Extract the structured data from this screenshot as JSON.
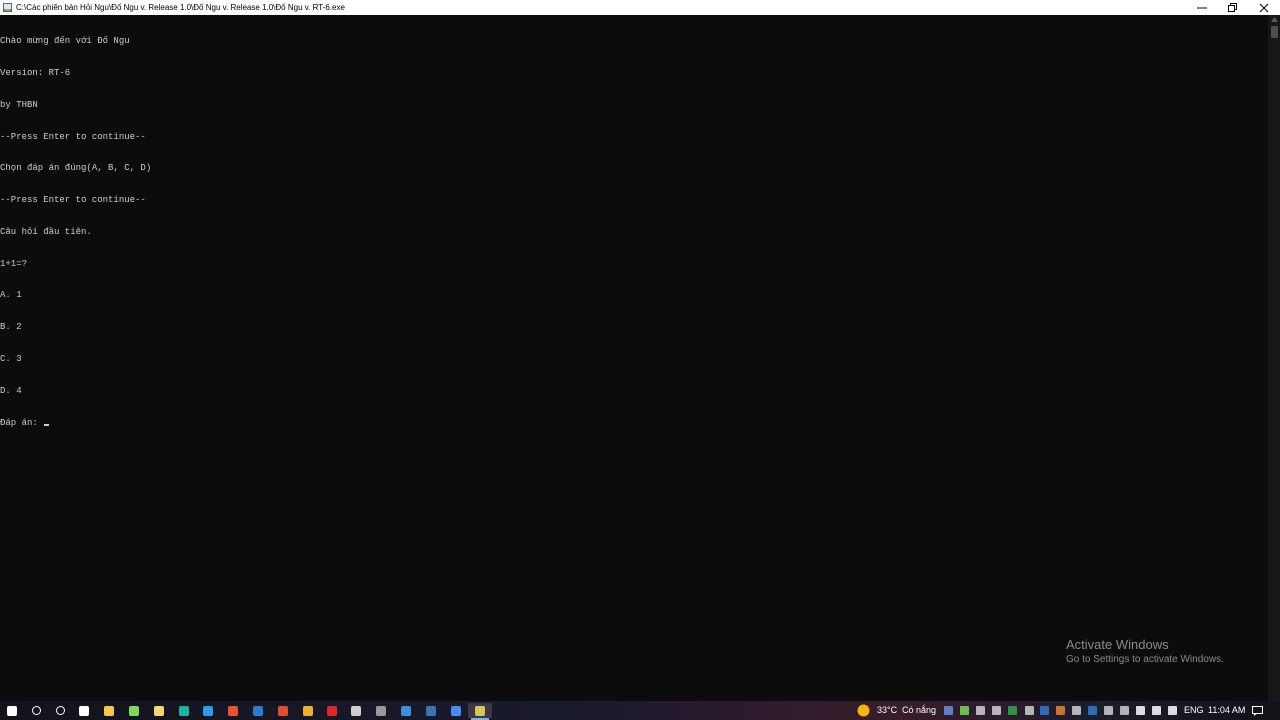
{
  "window": {
    "title": "C:\\Các phiên bản Hỏi Ngu\\Đố Ngu v. Release 1.0\\Đố Ngu v. Release 1.0\\Đố Ngu v. RT-6.exe",
    "controls": {
      "minimize": "—",
      "maximize": "❐",
      "close": "✕"
    }
  },
  "console": {
    "lines": [
      "Chào mừng đến với Đố Ngu",
      "Version: RT-6",
      "by THBN",
      "--Press Enter to continue--",
      "Chọn đáp án đúng(A, B, C, D)",
      "--Press Enter to continue--",
      "Câu hỏi đầu tiên.",
      "1+1=?",
      "A. 1",
      "B. 2",
      "C. 3",
      "D. 4"
    ],
    "prompt": "Đáp án: "
  },
  "watermark": {
    "title": "Activate Windows",
    "subtitle": "Go to Settings to activate Windows."
  },
  "taskbar": {
    "icons": [
      {
        "name": "start-icon",
        "color": "#ffffff"
      },
      {
        "name": "search-icon",
        "color": "#ffffff"
      },
      {
        "name": "cortana-icon",
        "color": "#ffffff"
      },
      {
        "name": "task-view-icon",
        "color": "#ffffff"
      },
      {
        "name": "file-explorer-icon",
        "color": "#f2c94c"
      },
      {
        "name": "store-icon",
        "color": "#7ed957"
      },
      {
        "name": "app-icon-1",
        "color": "#f5d76e"
      },
      {
        "name": "app-icon-2",
        "color": "#19b6a6"
      },
      {
        "name": "edge-icon",
        "color": "#2d9bf0"
      },
      {
        "name": "office-icon",
        "color": "#e8542e"
      },
      {
        "name": "mail-icon",
        "color": "#2b7cd3"
      },
      {
        "name": "app-icon-3",
        "color": "#e04f2e"
      },
      {
        "name": "chrome-icon",
        "color": "#e9b22a"
      },
      {
        "name": "opera-icon",
        "color": "#e0262c"
      },
      {
        "name": "pycharm-icon",
        "color": "#cfcfcf"
      },
      {
        "name": "terminal-icon",
        "color": "#9a9a9a"
      },
      {
        "name": "chat-icon",
        "color": "#3b8fe0"
      },
      {
        "name": "python-icon",
        "color": "#3a76b0"
      },
      {
        "name": "browser-icon",
        "color": "#4c8bf5"
      },
      {
        "name": "console-app-icon",
        "color": "#d9c65b"
      }
    ],
    "weather": {
      "temp": "33°C",
      "condition": "Có nắng"
    },
    "tray_icons": [
      {
        "name": "teams-icon",
        "color": "#6b8fe0"
      },
      {
        "name": "security-icon",
        "color": "#7ed957"
      },
      {
        "name": "tray-app-icon-1",
        "color": "#cfcfcf"
      },
      {
        "name": "tray-app-icon-2",
        "color": "#cfcfcf"
      },
      {
        "name": "tray-app-icon-3",
        "color": "#2fa84f"
      },
      {
        "name": "tray-app-icon-4",
        "color": "#cfcfcf"
      },
      {
        "name": "tray-app-icon-5",
        "color": "#2b7cd3"
      },
      {
        "name": "tray-app-icon-6",
        "color": "#e8842e"
      },
      {
        "name": "tray-app-icon-7",
        "color": "#cfcfcf"
      },
      {
        "name": "tray-app-icon-8",
        "color": "#2b7cd3"
      },
      {
        "name": "tray-app-icon-9",
        "color": "#cfcfcf"
      },
      {
        "name": "tray-app-icon-10",
        "color": "#cfcfcf"
      },
      {
        "name": "volume-icon",
        "color": "#ffffff"
      },
      {
        "name": "battery-icon",
        "color": "#ffffff"
      },
      {
        "name": "network-icon",
        "color": "#ffffff"
      }
    ],
    "language": "ENG",
    "time": "11:04 AM",
    "notification_icon": "notification-icon"
  }
}
